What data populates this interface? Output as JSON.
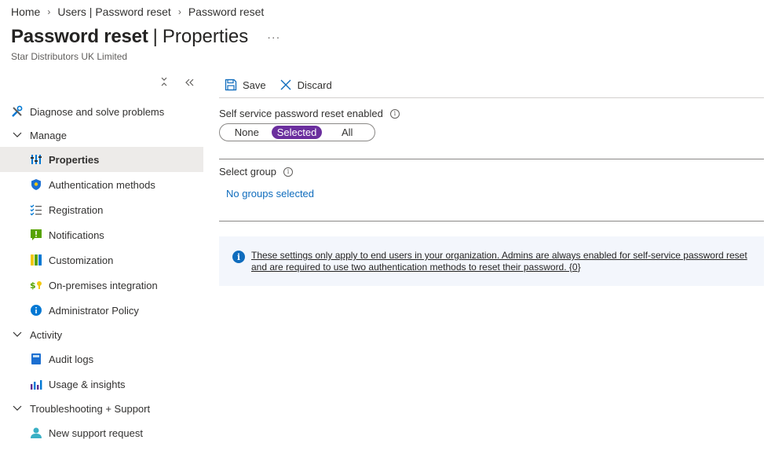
{
  "breadcrumb": [
    "Home",
    "Users | Password reset",
    "Password reset"
  ],
  "header": {
    "title_strong": "Password reset",
    "title_sep": "|",
    "title_light": "Properties",
    "more": "···",
    "subtitle": "Star Distributors UK Limited"
  },
  "sidebar": {
    "controls": {
      "pin": "×",
      "collapse": "«"
    },
    "items": [
      {
        "label": "Diagnose and solve problems",
        "icon": "wrench-icon"
      },
      {
        "label": "Manage",
        "icon": "chevron-down-icon"
      },
      {
        "label": "Properties",
        "icon": "properties-icon",
        "active": true
      },
      {
        "label": "Authentication methods",
        "icon": "shield-icon"
      },
      {
        "label": "Registration",
        "icon": "checklist-icon"
      },
      {
        "label": "Notifications",
        "icon": "notification-icon"
      },
      {
        "label": "Customization",
        "icon": "customization-icon"
      },
      {
        "label": "On-premises integration",
        "icon": "onprem-icon"
      },
      {
        "label": "Administrator Policy",
        "icon": "info-icon"
      },
      {
        "label": "Activity",
        "icon": "chevron-down-icon"
      },
      {
        "label": "Audit logs",
        "icon": "book-icon"
      },
      {
        "label": "Usage & insights",
        "icon": "bar-chart-icon"
      },
      {
        "label": "Troubleshooting + Support",
        "icon": "chevron-down-icon"
      },
      {
        "label": "New support request",
        "icon": "support-person-icon"
      }
    ]
  },
  "toolbar": {
    "save_label": "Save",
    "discard_label": "Discard"
  },
  "sspr": {
    "label": "Self service password reset enabled",
    "options": [
      "None",
      "Selected",
      "All"
    ],
    "selected": "Selected"
  },
  "group": {
    "label": "Select group",
    "value": "No groups selected"
  },
  "banner": {
    "text": "These settings only apply to end users in your organization. Admins are always enabled for self-service password reset and are required to use two authentication methods to reset their password. {0}"
  },
  "colors": {
    "accent": "#6b2f9e",
    "link": "#0f6cbd",
    "info_bg": "#f3f6fc"
  }
}
